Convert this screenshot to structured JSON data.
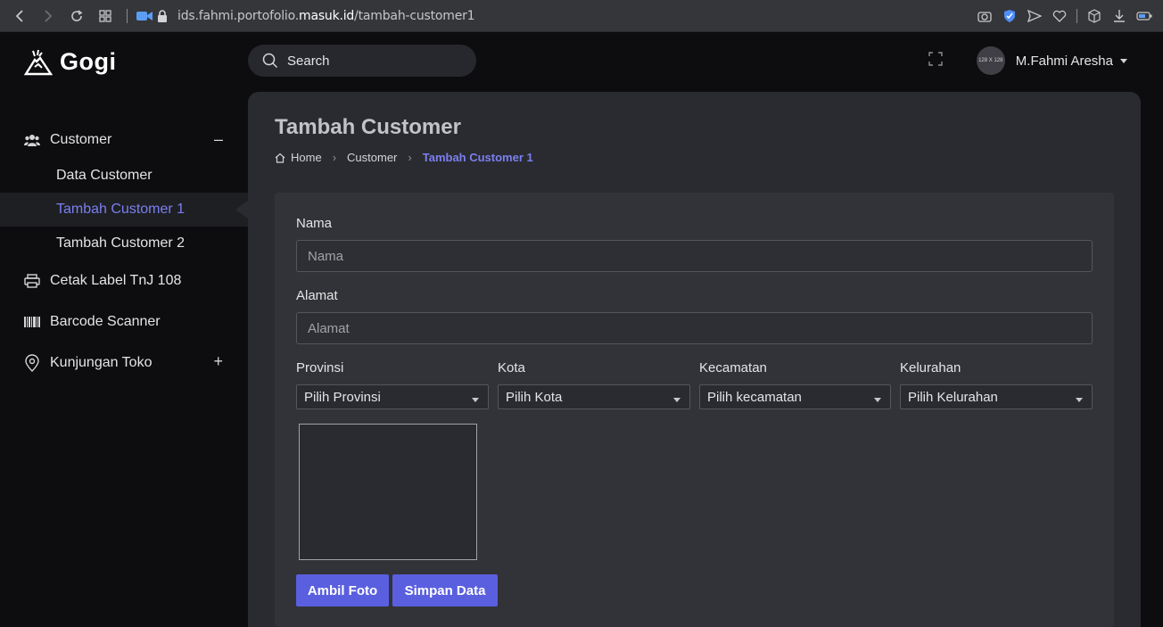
{
  "browser": {
    "url_prefix": "ids.fahmi.portofolio.",
    "url_domain": "masuk.id",
    "url_path": "/tambah-customer1"
  },
  "app": {
    "name": "Gogi"
  },
  "sidebar": {
    "customer": {
      "label": "Customer",
      "toggle": "–"
    },
    "subitems": [
      {
        "label": "Data Customer"
      },
      {
        "label": "Tambah Customer 1"
      },
      {
        "label": "Tambah Customer 2"
      }
    ],
    "items": [
      {
        "label": "Cetak Label TnJ 108"
      },
      {
        "label": "Barcode Scanner"
      },
      {
        "label": "Kunjungan Toko",
        "toggle": "+"
      }
    ]
  },
  "search": {
    "placeholder": "Search"
  },
  "user": {
    "name": "M.Fahmi Aresha",
    "avatar_text": "128 X 128"
  },
  "page": {
    "title": "Tambah Customer",
    "breadcrumb": [
      "Home",
      "Customer",
      "Tambah Customer 1"
    ]
  },
  "form": {
    "nama_label": "Nama",
    "nama_placeholder": "Nama",
    "alamat_label": "Alamat",
    "alamat_placeholder": "Alamat",
    "provinsi_label": "Provinsi",
    "provinsi_value": "Pilih Provinsi",
    "kota_label": "Kota",
    "kota_value": "Pilih Kota",
    "kecamatan_label": "Kecamatan",
    "kecamatan_value": "Pilih kecamatan",
    "kelurahan_label": "Kelurahan",
    "kelurahan_value": "Pilih Kelurahan",
    "ambil_foto": "Ambil Foto",
    "simpan_data": "Simpan Data"
  },
  "colors": {
    "accent": "#5a5fe0",
    "active_text": "#7b7ff0",
    "background": "#0d0d0f",
    "panel": "#2a2b30"
  }
}
